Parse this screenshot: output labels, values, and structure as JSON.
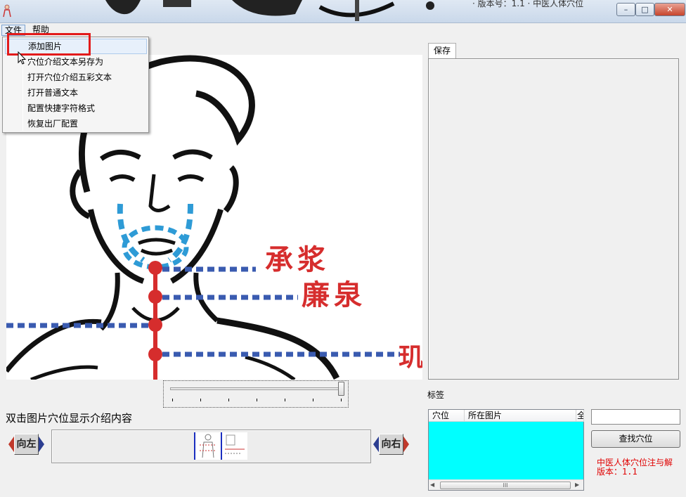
{
  "window": {
    "title_fragment": "· 版本号：1.1 · 中医人体穴位",
    "minimize_label": "–",
    "maximize_label": "□",
    "close_label": "✕"
  },
  "menubar": {
    "file": "文件",
    "help": "帮助"
  },
  "file_menu": {
    "items": [
      "添加图片",
      "穴位介绍文本另存为",
      "打开穴位介绍五彩文本",
      "打开普通文本",
      "配置快捷字符格式",
      "恢复出厂配置"
    ]
  },
  "image_labels": {
    "acupoint_1": "承浆",
    "acupoint_2": "廉泉",
    "acupoint_3_partial": "玑"
  },
  "right_panel": {
    "save_tab": "保存"
  },
  "hint_text": "双击图片穴位显示介绍内容",
  "tag_label": "标签",
  "nav": {
    "left": "向左",
    "right": "向右"
  },
  "listview": {
    "columns": [
      "穴位",
      "所在图片",
      "全"
    ],
    "scroll_grip": "III"
  },
  "search": {
    "value": "",
    "button": "查找穴位"
  },
  "about": {
    "name": "中医人体穴位注与解",
    "version": "版本：1.1"
  },
  "colors": {
    "highlight_red": "#e21b1b",
    "acupoint_red": "#d62d2d",
    "meridian_blue": "#3a5bb0",
    "face_blue": "#2e9bd6",
    "listview_cyan": "#00ffff",
    "about_red": "#e00000"
  },
  "slider": {
    "level": 1.0,
    "ticks": 7
  }
}
